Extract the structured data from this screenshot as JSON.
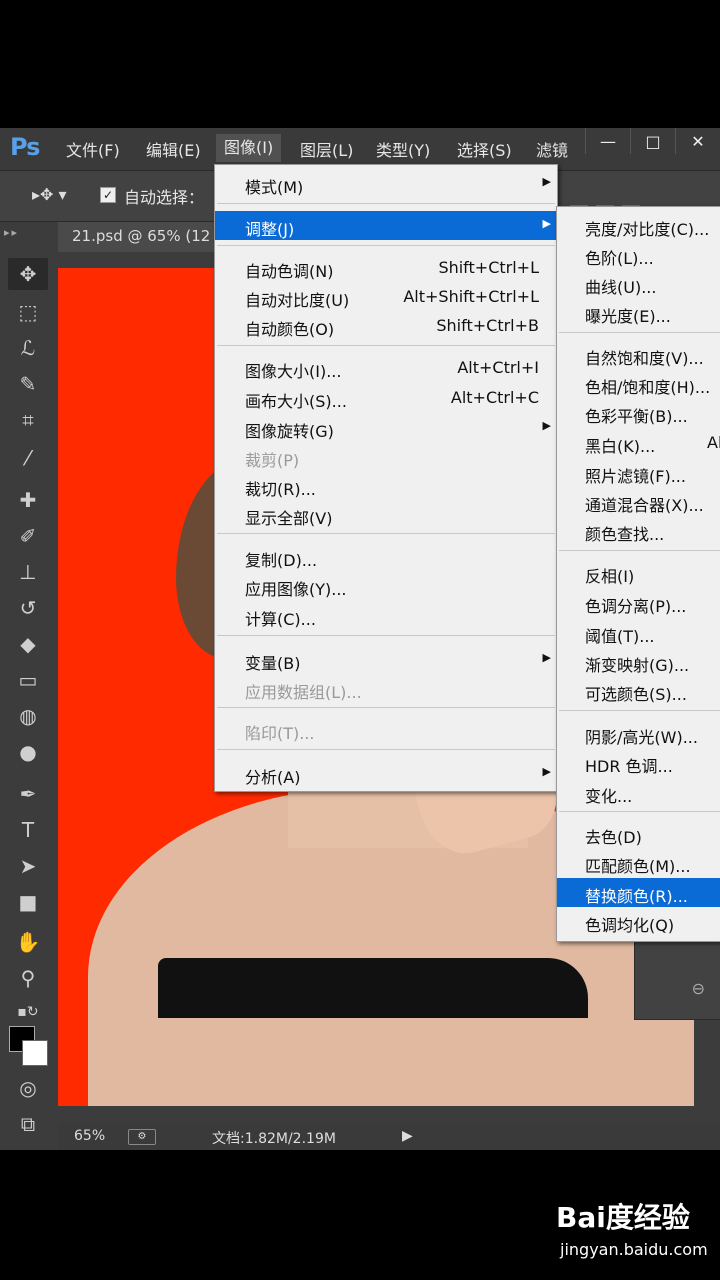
{
  "app": {
    "logo": "Ps",
    "menus": [
      "文件(F)",
      "编辑(E)",
      "图像(I)",
      "图层(L)",
      "类型(Y)",
      "选择(S)",
      "滤镜"
    ],
    "window_buttons": [
      "—",
      "□",
      "✕"
    ]
  },
  "options": {
    "auto_select_label": "自动选择："
  },
  "document": {
    "tab_title": "21.psd @ 65% (12"
  },
  "status": {
    "zoom": "65%",
    "doc_size": "文档:1.82M/2.19M"
  },
  "image_menu": {
    "items": [
      {
        "label": "模式(M)",
        "shortcut": "",
        "submenu": true,
        "disabled": false
      },
      {
        "label": "调整(J)",
        "shortcut": "",
        "submenu": true,
        "disabled": false,
        "highlighted": true
      },
      {
        "label": "自动色调(N)",
        "shortcut": "Shift+Ctrl+L"
      },
      {
        "label": "自动对比度(U)",
        "shortcut": "Alt+Shift+Ctrl+L"
      },
      {
        "label": "自动颜色(O)",
        "shortcut": "Shift+Ctrl+B"
      },
      {
        "label": "图像大小(I)...",
        "shortcut": "Alt+Ctrl+I"
      },
      {
        "label": "画布大小(S)...",
        "shortcut": "Alt+Ctrl+C"
      },
      {
        "label": "图像旋转(G)",
        "shortcut": "",
        "submenu": true
      },
      {
        "label": "裁剪(P)",
        "shortcut": "",
        "disabled": true
      },
      {
        "label": "裁切(R)...",
        "shortcut": ""
      },
      {
        "label": "显示全部(V)",
        "shortcut": ""
      },
      {
        "label": "复制(D)...",
        "shortcut": ""
      },
      {
        "label": "应用图像(Y)...",
        "shortcut": ""
      },
      {
        "label": "计算(C)...",
        "shortcut": ""
      },
      {
        "label": "变量(B)",
        "shortcut": "",
        "submenu": true
      },
      {
        "label": "应用数据组(L)...",
        "shortcut": "",
        "disabled": true
      },
      {
        "label": "陷印(T)...",
        "shortcut": "",
        "disabled": true
      },
      {
        "label": "分析(A)",
        "shortcut": "",
        "submenu": true
      }
    ]
  },
  "adjust_submenu": {
    "items": [
      {
        "label": "亮度/对比度(C)..."
      },
      {
        "label": "色阶(L)..."
      },
      {
        "label": "曲线(U)..."
      },
      {
        "label": "曝光度(E)..."
      },
      {
        "label": "自然饱和度(V)..."
      },
      {
        "label": "色相/饱和度(H)..."
      },
      {
        "label": "色彩平衡(B)..."
      },
      {
        "label": "黑白(K)...",
        "extra": "Al"
      },
      {
        "label": "照片滤镜(F)..."
      },
      {
        "label": "通道混合器(X)..."
      },
      {
        "label": "颜色查找..."
      },
      {
        "label": "反相(I)"
      },
      {
        "label": "色调分离(P)..."
      },
      {
        "label": "阈值(T)..."
      },
      {
        "label": "渐变映射(G)..."
      },
      {
        "label": "可选颜色(S)..."
      },
      {
        "label": "阴影/高光(W)..."
      },
      {
        "label": "HDR 色调..."
      },
      {
        "label": "变化..."
      },
      {
        "label": "去色(D)"
      },
      {
        "label": "匹配颜色(M)..."
      },
      {
        "label": "替换颜色(R)...",
        "highlighted": true
      },
      {
        "label": "色调均化(Q)"
      }
    ]
  },
  "watermark": {
    "brand": "Bai度经验",
    "url": "jingyan.baidu.com"
  }
}
